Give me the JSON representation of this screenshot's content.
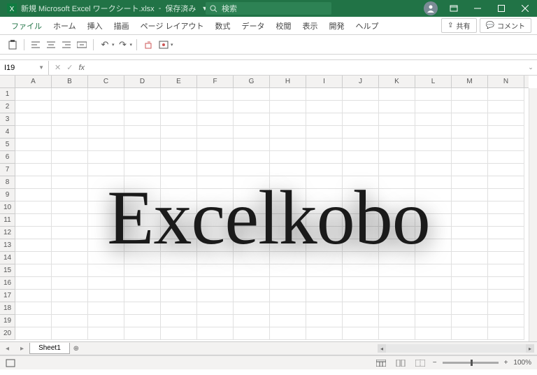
{
  "titlebar": {
    "filename": "新規 Microsoft Excel ワークシート.xlsx",
    "save_state": "保存済み"
  },
  "search": {
    "placeholder": "検索"
  },
  "ribbon": {
    "tabs": [
      "ファイル",
      "ホーム",
      "挿入",
      "描画",
      "ページ レイアウト",
      "数式",
      "データ",
      "校閲",
      "表示",
      "開発",
      "ヘルプ"
    ],
    "share": "共有",
    "comment": "コメント"
  },
  "cell_ref": "I19",
  "columns": [
    "A",
    "B",
    "C",
    "D",
    "E",
    "F",
    "G",
    "H",
    "I",
    "J",
    "K",
    "L",
    "M",
    "N"
  ],
  "rows": [
    "1",
    "2",
    "3",
    "4",
    "5",
    "6",
    "7",
    "8",
    "9",
    "10",
    "11",
    "12",
    "13",
    "14",
    "15",
    "16",
    "17",
    "18",
    "19",
    "20"
  ],
  "watermark": "Excelkobo",
  "sheet": {
    "name": "Sheet1"
  },
  "zoom": "100%"
}
